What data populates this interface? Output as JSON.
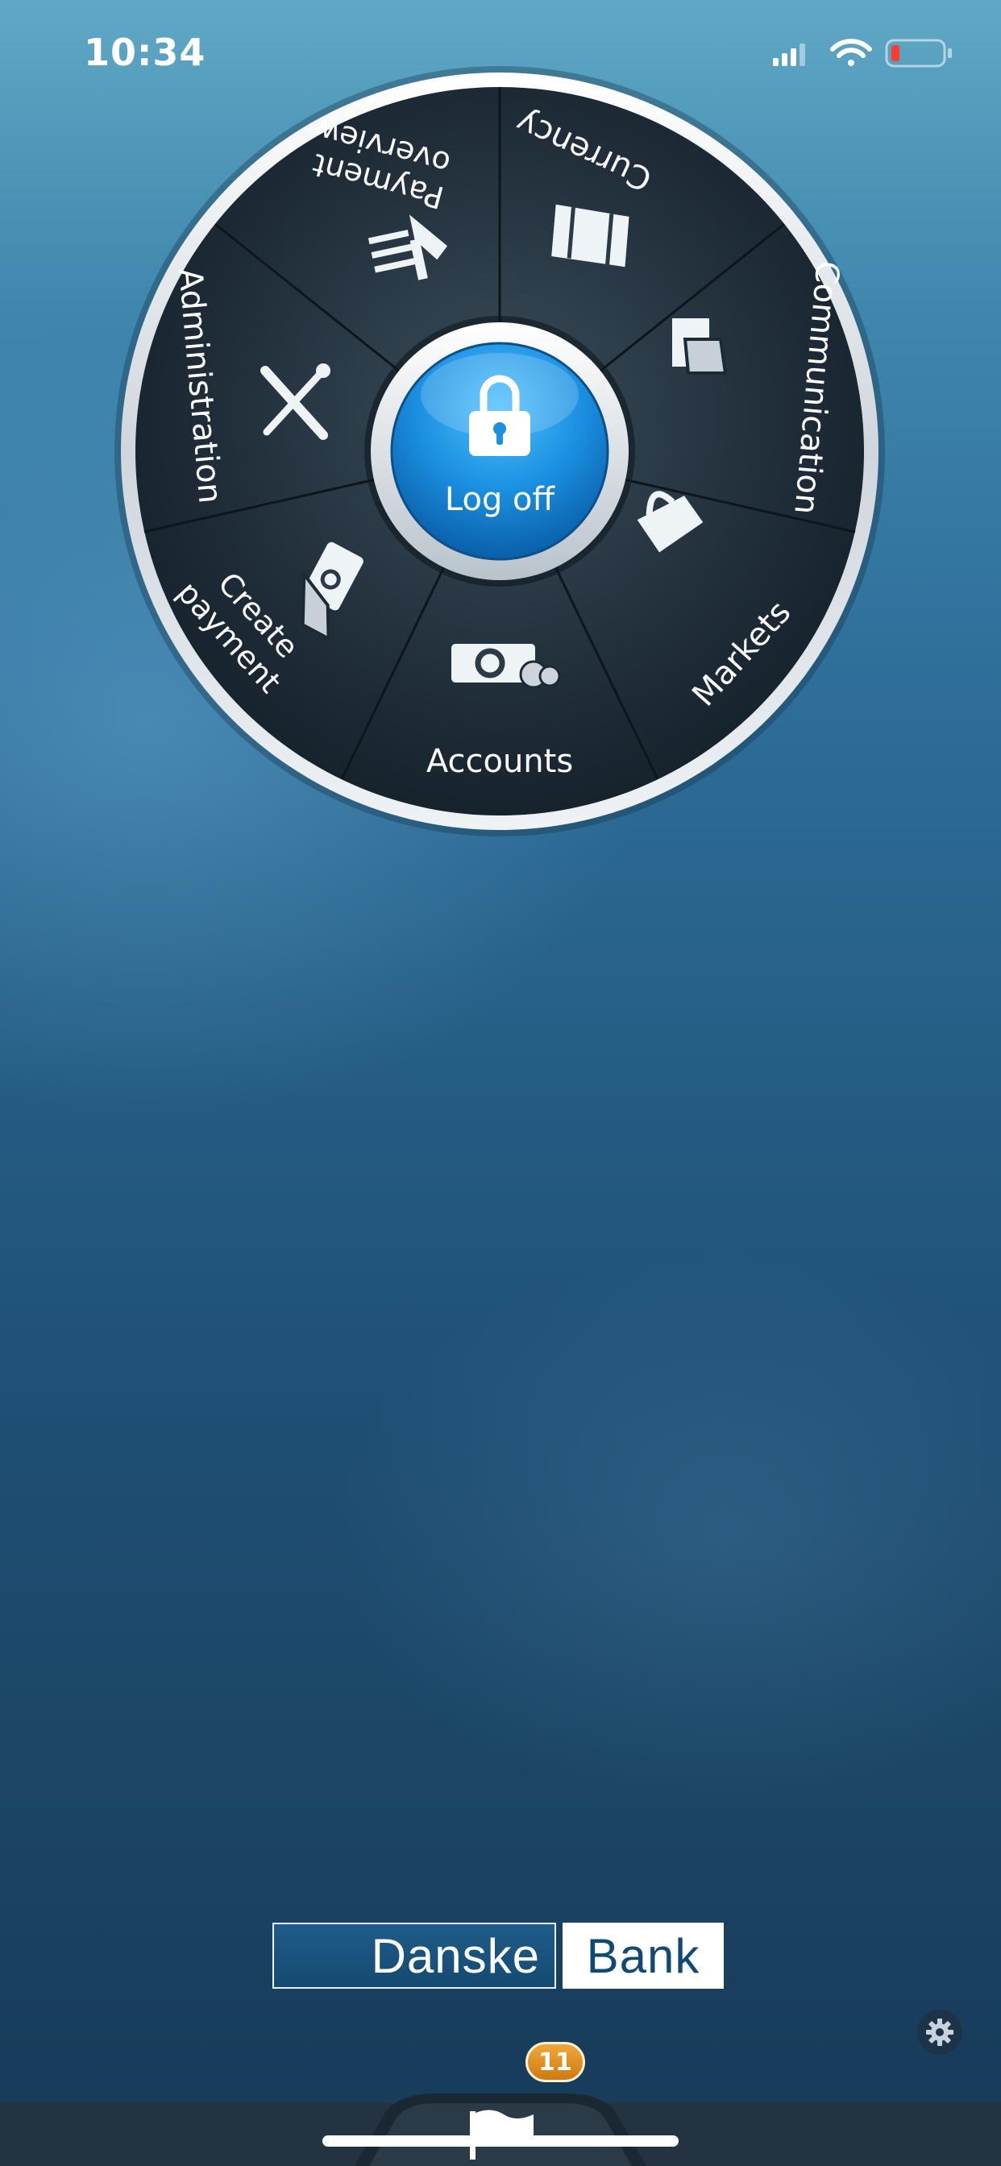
{
  "status_bar": {
    "time": "10:34",
    "icons": [
      "cellular-signal-icon",
      "wifi-icon",
      "battery-low-icon"
    ]
  },
  "menu": {
    "center": {
      "label": "Log off",
      "icon": "padlock-icon"
    },
    "sections": [
      {
        "id": "currency",
        "label": "Currency",
        "icon": "currency-icon"
      },
      {
        "id": "communication",
        "label": "Communication",
        "icon": "communication-icon"
      },
      {
        "id": "markets",
        "label": "Markets",
        "icon": "markets-icon"
      },
      {
        "id": "accounts",
        "label": "Accounts",
        "icon": "accounts-icon"
      },
      {
        "id": "create-payment",
        "label": "Create payment",
        "lines": [
          "Create",
          "payment"
        ],
        "icon": "create-payment-icon"
      },
      {
        "id": "administration",
        "label": "Administration",
        "icon": "tools-icon"
      },
      {
        "id": "payment-overview",
        "label": "Payment overview",
        "lines": [
          "Payment",
          "overview"
        ],
        "icon": "payment-overview-icon"
      }
    ]
  },
  "logo": {
    "left": "Danske",
    "right": "Bank"
  },
  "notifications": {
    "badge_count": "11",
    "icon": "flag-icon"
  },
  "settings": {
    "icon": "gear-icon"
  },
  "colors": {
    "center_button": "#1e8ed8",
    "wheel_dark": "#1c2a36",
    "badge": "#e08a1e",
    "battery_low": "#ff3b30"
  }
}
